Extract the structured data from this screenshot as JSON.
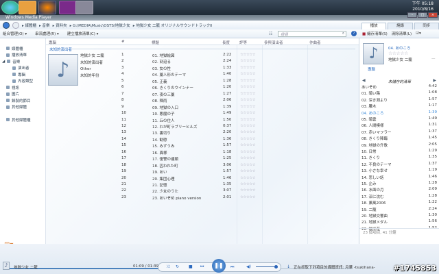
{
  "taskbar": {
    "clock_time": "下午 05:18",
    "clock_date": "2010/8/16"
  },
  "window": {
    "title": "Windows Media Player"
  },
  "breadcrumb": [
    "媒體櫃",
    "音樂",
    "資料夾",
    "G:\\MEDIA\\Music\\OSTS\\地獄少女",
    "地獄少女 二籠 オリジナルサウンドトラックⅡ"
  ],
  "tabs": [
    "播放",
    "燒錄",
    "同步"
  ],
  "toolbar": {
    "organize": "組合管理(O)",
    "stream": "串流處理(R)",
    "create_playlist": "建立播放清單(C)",
    "search_placeholder": "搜尋",
    "save_list": "儲存清單(S)",
    "clear_list": "清除清單(L)"
  },
  "sidebar": [
    "媒體櫃",
    "播放清單",
    "音樂",
    "演出者",
    "專輯",
    "內容類型",
    "視訊",
    "圖片",
    "錄製的節目",
    "其他媒體",
    "其他媒體櫃"
  ],
  "columns": {
    "album": "專輯",
    "num": "#",
    "title": "標題",
    "length": "長度",
    "rating": "評等",
    "contrib": "參與演出者",
    "composer": "作曲者"
  },
  "group": "未知的演出者",
  "album_info": [
    "地獄少女 二籠",
    "未知的演出者",
    "Other",
    "未知的年份"
  ],
  "tracks": [
    [
      "1",
      "01. 地獄絵図",
      "2:22"
    ],
    [
      "2",
      "02. 刻迫る",
      "2:24"
    ],
    [
      "3",
      "03. 女の性",
      "1:33"
    ],
    [
      "4",
      "04. 藁人形のテーマ",
      "1:40"
    ],
    [
      "5",
      "05. 正義",
      "1:28"
    ],
    [
      "6",
      "06. きくりのウインナー",
      "1:20"
    ],
    [
      "7",
      "07. 夜の三藁",
      "1:27"
    ],
    [
      "8",
      "08. 陣雨",
      "2:06"
    ],
    [
      "9",
      "09. 地獄の入口",
      "1:39"
    ],
    [
      "10",
      "10. 悪魔の子",
      "1:49"
    ],
    [
      "11",
      "11. 丘の住人",
      "1:50"
    ],
    [
      "12",
      "12. わが町ラブリーヒルズ",
      "0:37"
    ],
    [
      "13",
      "13. 裏切り",
      "2:20"
    ],
    [
      "14",
      "14. 勧懲",
      "1:36"
    ],
    [
      "15",
      "15. みずうみ",
      "1:57"
    ],
    [
      "16",
      "16. 異様",
      "1:18"
    ],
    [
      "17",
      "17. 復讐の連鎖",
      "1:25"
    ],
    [
      "18",
      "18. 囚われた町",
      "3:06"
    ],
    [
      "19",
      "19. あい",
      "1:57"
    ],
    [
      "20",
      "20. 集団心理",
      "1:46"
    ],
    [
      "21",
      "21. 記憶",
      "1:35"
    ],
    [
      "22",
      "22. 少女のうた",
      "3:07"
    ],
    [
      "23",
      "23. あいぞめ piano version",
      "2:01"
    ]
  ],
  "rating_stars": "☆☆☆☆☆",
  "now_playing": {
    "title": "04. あのころ",
    "album": "地獄少女 二籠",
    "dash": "—",
    "art_label": "專輯"
  },
  "playlist": {
    "title": "未儲存的清單",
    "items": [
      [
        "あいぞめ",
        "4:42"
      ],
      [
        "01. 暗い路",
        "1:08"
      ],
      [
        "02. 深き淵より",
        "1:57"
      ],
      [
        "03. 腰木",
        "1:17"
      ],
      [
        "04. あのころ",
        "1:39"
      ],
      [
        "05. 暗雲",
        "1:49"
      ],
      [
        "06. 人間模様",
        "1:31"
      ],
      [
        "07. 赤いマフラー",
        "1:37"
      ],
      [
        "08. きくり降臨",
        "1:45"
      ],
      [
        "09. 地獄の升歌",
        "2:05"
      ],
      [
        "10. 日常",
        "1:29"
      ],
      [
        "11. きくり",
        "1:35"
      ],
      [
        "12. 不良のテーマ",
        "1:37"
      ],
      [
        "13. 小さな幸せ",
        "1:19"
      ],
      [
        "14. 悲しい話",
        "1:46"
      ],
      [
        "15. 企み",
        "1:28"
      ],
      [
        "16. 水面の月",
        "2:09"
      ],
      [
        "17. 深に沈む",
        "1:28"
      ],
      [
        "18. 薫風2006",
        "1:22"
      ],
      [
        "19. 二籠",
        "2:24"
      ],
      [
        "20. 地獄交響曲",
        "1:30"
      ],
      [
        "21. 地獄メダル",
        "1:56"
      ],
      [
        "22. 彼岸花",
        "1:52"
      ]
    ],
    "current_index": 4,
    "summary": "23 個項目, 41 分鐘"
  },
  "player": {
    "album": "地獄少女 二籠",
    "time": "01:09 / 01:39",
    "progress": 0.7,
    "volume": 0.9,
    "status": "正在抓取下列項目的媒體資訊: 月華 -tsukihana-"
  },
  "watermark": "#1745853"
}
